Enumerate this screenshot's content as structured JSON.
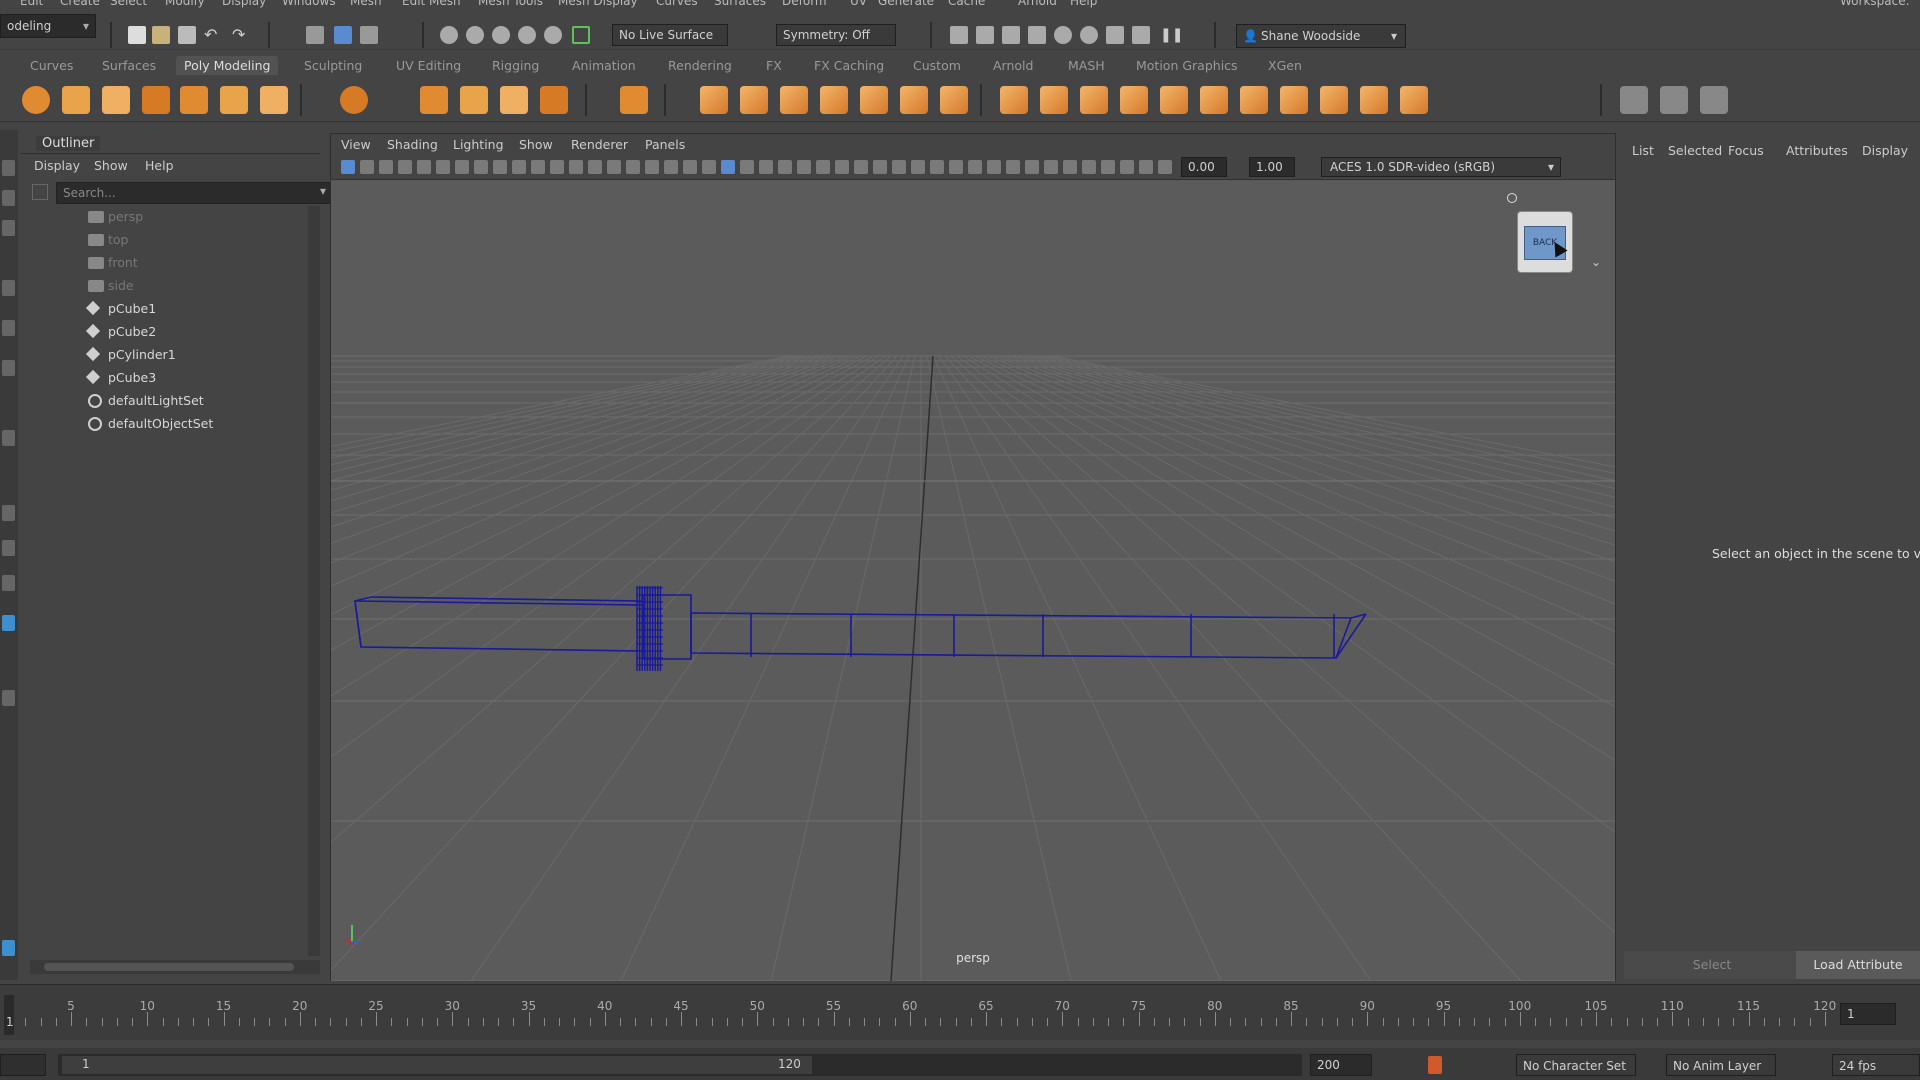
{
  "menubar": {
    "items": [
      "Edit",
      "Create",
      "Select",
      "Modify",
      "Display",
      "Windows",
      "Mesh",
      "Edit Mesh",
      "Mesh Tools",
      "Mesh Display",
      "Curves",
      "Surfaces",
      "Deform",
      "UV",
      "Generate",
      "Cache",
      "Arnold",
      "Help"
    ],
    "workspace_label": "Workspace:"
  },
  "statusline": {
    "mode_select": "odeling",
    "live_surface": "No Live Surface",
    "symmetry": "Symmetry: Off",
    "user_name": "Shane Woodside"
  },
  "shelf": {
    "tabs": [
      "Curves",
      "Surfaces",
      "Poly Modeling",
      "Sculpting",
      "UV Editing",
      "Rigging",
      "Animation",
      "Rendering",
      "FX",
      "FX Caching",
      "Custom",
      "Arnold",
      "MASH",
      "Motion Graphics",
      "XGen"
    ],
    "active_tab": "Poly Modeling"
  },
  "outliner": {
    "title": "Outliner",
    "menu": [
      "Display",
      "Show",
      "Help"
    ],
    "search_placeholder": "Search...",
    "items": [
      {
        "label": "persp",
        "type": "camera",
        "dim": true
      },
      {
        "label": "top",
        "type": "camera",
        "dim": true
      },
      {
        "label": "front",
        "type": "camera",
        "dim": true
      },
      {
        "label": "side",
        "type": "camera",
        "dim": true
      },
      {
        "label": "pCube1",
        "type": "mesh",
        "dim": false
      },
      {
        "label": "pCube2",
        "type": "mesh",
        "dim": false
      },
      {
        "label": "pCylinder1",
        "type": "mesh",
        "dim": false
      },
      {
        "label": "pCube3",
        "type": "mesh",
        "dim": false
      },
      {
        "label": "defaultLightSet",
        "type": "set",
        "dim": false
      },
      {
        "label": "defaultObjectSet",
        "type": "set",
        "dim": false
      }
    ]
  },
  "viewport": {
    "menu": [
      "View",
      "Shading",
      "Lighting",
      "Show",
      "Renderer",
      "Panels"
    ],
    "exposure": "0.00",
    "gamma": "1.00",
    "color_space": "ACES 1.0 SDR-video (sRGB)",
    "camera_label": "persp",
    "viewcube_label": "BACK"
  },
  "attribute_editor": {
    "tabs": [
      "List",
      "Selected",
      "Focus",
      "Attributes",
      "Display"
    ],
    "message": "Select an object in the scene to vie",
    "select_button": "Select",
    "load_button": "Load Attribute"
  },
  "timeline": {
    "ticks": [
      "5",
      "10",
      "15",
      "20",
      "25",
      "30",
      "35",
      "40",
      "45",
      "50",
      "55",
      "60",
      "65",
      "70",
      "75",
      "80",
      "85",
      "90",
      "95",
      "100",
      "105",
      "110",
      "115",
      "120"
    ],
    "current_frame": "1",
    "current_frame_left": "1"
  },
  "rangebar": {
    "start": "1",
    "range_end": "120",
    "anim_end": "200",
    "character_set": "No Character Set",
    "anim_layer": "No Anim Layer",
    "fps": "24 fps"
  },
  "colors": {
    "accent": "#f0a030",
    "wire": "#1a1a9a",
    "selected_tab": "#525252"
  }
}
